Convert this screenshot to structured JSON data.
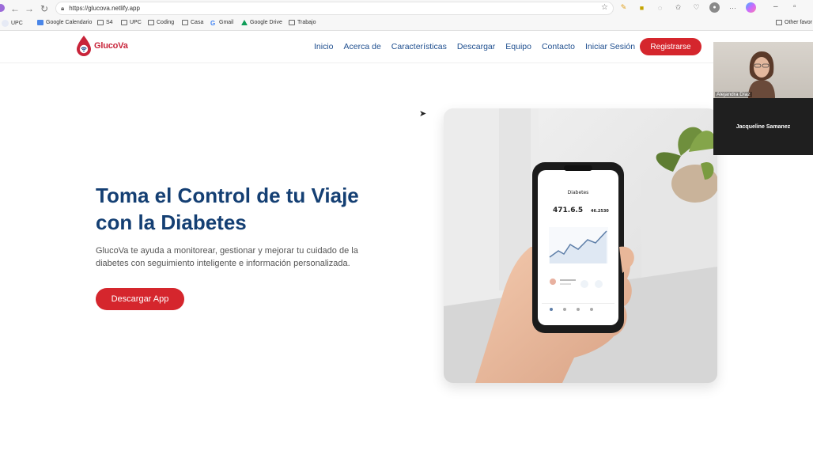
{
  "browser": {
    "url": "https://glucova.netlify.app",
    "bookmarks": [
      "UPC",
      "Google Calendario",
      "S4",
      "UPC",
      "Coding",
      "Casa",
      "Gmail",
      "Google Drive",
      "Trabajo"
    ],
    "other_favorites": "Other favor"
  },
  "header": {
    "logo_text": "GlucoVa",
    "nav": [
      "Inicio",
      "Acerca de",
      "Características",
      "Descargar",
      "Equipo",
      "Contacto",
      "Iniciar Sesión"
    ],
    "register_label": "Registrarse"
  },
  "hero": {
    "title_line1": "Toma el Control de tu Viaje",
    "title_line2": "con la Diabetes",
    "subtitle_line1": "GlucoVa te ayuda a monitorear, gestionar y mejorar tu cuidado de la",
    "subtitle_line2": "diabetes con seguimiento inteligente e información personalizada.",
    "cta_label": "Descargar App"
  },
  "phone": {
    "screen_title": "Diabetes",
    "value_main": "471.6.5",
    "value_side": "46.2530"
  },
  "call": {
    "participant_1": "Alejandra Díaz",
    "participant_2": "Jacqueline Samanez"
  },
  "colors": {
    "brand_red": "#d5262d",
    "brand_blue": "#143f73",
    "nav_blue": "#1f4f8f"
  }
}
